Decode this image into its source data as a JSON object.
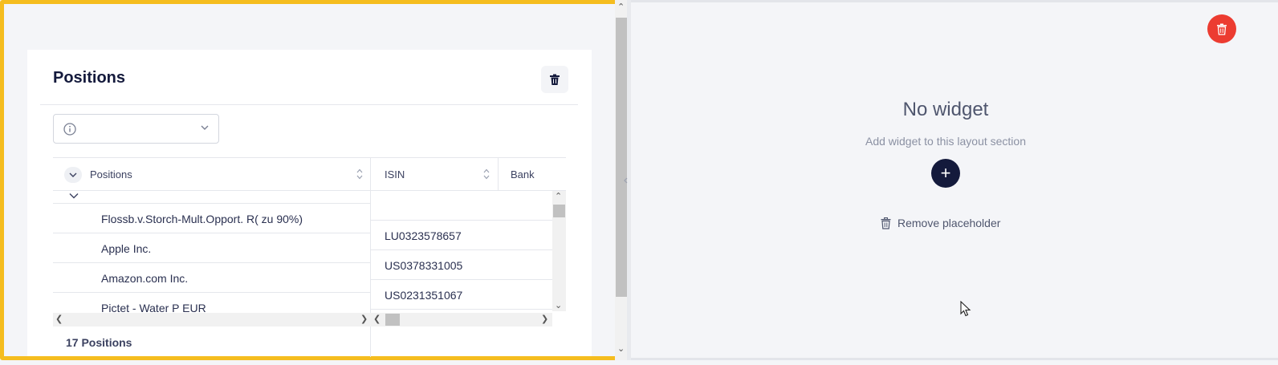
{
  "left_widget": {
    "title": "Positions",
    "grid": {
      "columns": [
        {
          "label": "Positions"
        },
        {
          "label": "ISIN"
        },
        {
          "label": "Bank"
        }
      ],
      "rows": [
        {
          "position": "Flossb.v.Storch-Mult.Opport. R( zu 90%)",
          "isin": ""
        },
        {
          "position": "Apple Inc.",
          "isin": "LU0323578657"
        },
        {
          "position": "Amazon.com Inc.",
          "isin": "US0378331005"
        },
        {
          "position": "Pictet - Water P EUR",
          "isin": "US0231351067"
        }
      ],
      "footer": "17 Positions"
    },
    "icons": {
      "delete": "trash-icon",
      "info": "info-icon",
      "dropdown": "chevron-down-icon",
      "expand": "chevron-down-icon",
      "sort": "sort-icon"
    }
  },
  "right_section": {
    "empty_title": "No widget",
    "empty_subtitle": "Add widget to this layout section",
    "add_button": "+",
    "remove_label": "Remove placeholder"
  },
  "colors": {
    "selection_border": "#f5bd1f",
    "danger": "#ec3c31",
    "primary": "#141a3c"
  }
}
